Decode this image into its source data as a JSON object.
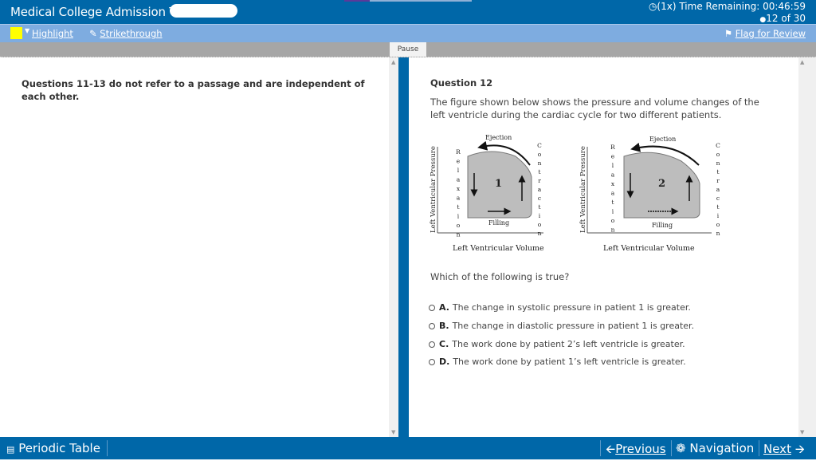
{
  "header": {
    "title": "Medical College Admission Test",
    "timer_label": "(1x) Time Remaining: 00:46:59",
    "question_count": "12 of 30"
  },
  "toolbar": {
    "highlight_label": "Highlight",
    "highlight_color": "#ffff00",
    "strikethrough_label": "Strikethrough",
    "flag_label": "Flag for Review"
  },
  "pause_label": "Pause",
  "passage": {
    "text": "Questions 11-13 do not refer to a passage and are independent of each other."
  },
  "question": {
    "title": "Question 12",
    "stem": "The figure shown below shows the pressure and volume changes of the left ventricle during the cardiac cycle for two different patients.",
    "prompt": "Which of the following is true?",
    "options": [
      {
        "letter": "A.",
        "text": "The change in systolic pressure in patient 1 is greater."
      },
      {
        "letter": "B.",
        "text": "The change in diastolic pressure in patient 1 is greater."
      },
      {
        "letter": "C.",
        "text": "The work done by patient 2’s left ventricle is greater."
      },
      {
        "letter": "D.",
        "text": "The work done by patient 1’s left ventricle is greater."
      }
    ]
  },
  "figure": {
    "panels": [
      {
        "number": "1",
        "ylabel": "Left Ventricular Pressure",
        "xlabel": "Left Ventricular Volume",
        "top": "Ejection",
        "bottom": "Filling",
        "left": "Relaxation",
        "right": "Contraction"
      },
      {
        "number": "2",
        "ylabel": "Left Ventricular Pressure",
        "xlabel": "Left Ventricular Volume",
        "top": "Ejection",
        "bottom": "Filling",
        "left": "Relaxation",
        "right": "Contraction"
      }
    ]
  },
  "footer": {
    "periodic_table_label": "Periodic Table",
    "previous_label": "Previous",
    "navigation_label": "Navigation",
    "next_label": "Next"
  }
}
